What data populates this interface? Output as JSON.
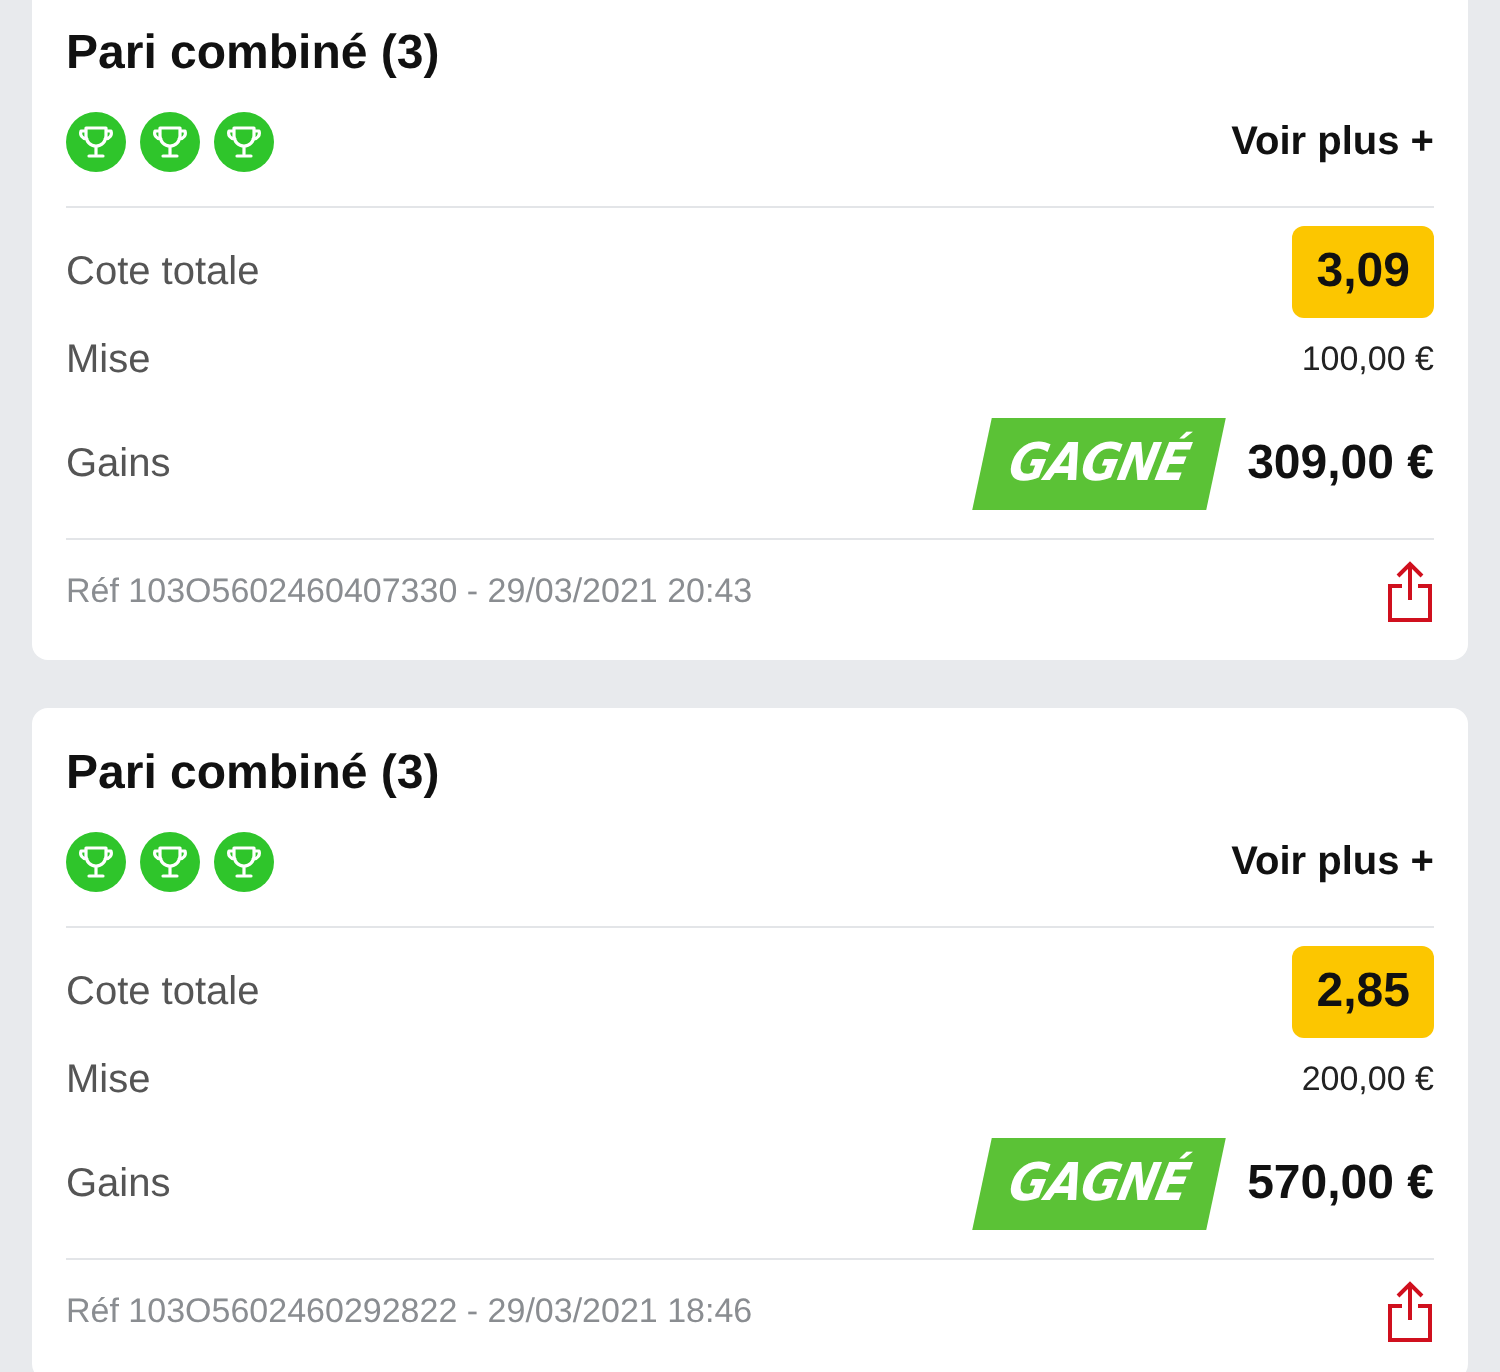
{
  "bets": [
    {
      "title": "Pari combiné (3)",
      "legs": [
        {
          "won": true
        },
        {
          "won": true
        },
        {
          "won": true
        }
      ],
      "more_link": "Voir plus +",
      "odds_label": "Cote totale",
      "odds": "3,09",
      "stake_label": "Mise",
      "stake": "100,00 €",
      "gains_label": "Gains",
      "status": {
        "kind": "won",
        "label": "GAGNÉ"
      },
      "gains": "309,00 €",
      "reference": "Réf 103O5602460407330 - 29/03/2021 20:43"
    },
    {
      "title": "Pari combiné (3)",
      "legs": [
        {
          "won": true
        },
        {
          "won": true
        },
        {
          "won": true
        }
      ],
      "more_link": "Voir plus +",
      "odds_label": "Cote totale",
      "odds": "2,85",
      "stake_label": "Mise",
      "stake": "200,00 €",
      "gains_label": "Gains",
      "status": {
        "kind": "won",
        "label": "GAGNÉ"
      },
      "gains": "570,00 €",
      "reference": "Réf 103O5602460292822 - 29/03/2021 18:46"
    }
  ]
}
